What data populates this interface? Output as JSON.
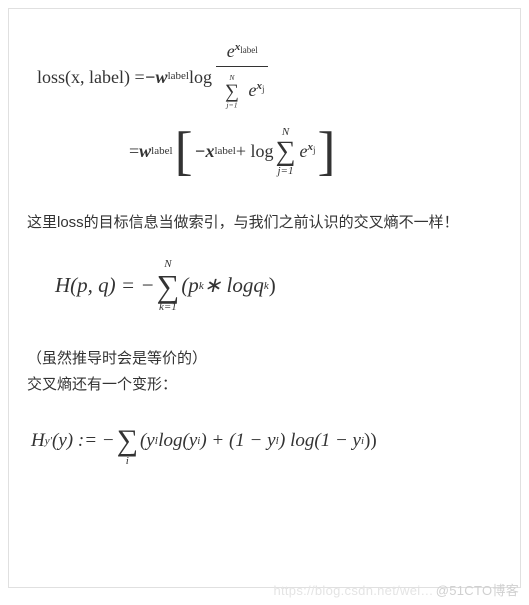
{
  "formula1": {
    "lhs": "loss(x, label) = ",
    "minus_w": "−w",
    "w_sub": "label",
    "log": " log ",
    "frac_num_e": "e",
    "frac_num_exp_x": "x",
    "frac_num_exp_sub": "label",
    "frac_den_sum_top": "N",
    "frac_den_sum_bot": "j=1",
    "frac_den_e": "e",
    "frac_den_exp_x": "x",
    "frac_den_exp_sub": "j",
    "line2_eq": "= ",
    "line2_w": "w",
    "line2_w_sub": "label",
    "line2_minus_x": "−x",
    "line2_x_sub": "label",
    "line2_plus_log": " + log ",
    "line2_sum_top": "N",
    "line2_sum_bot": "j=1",
    "line2_e": "e",
    "line2_exp_x": "x",
    "line2_exp_sub": "j"
  },
  "text1": "这里loss的目标信息当做索引，与我们之前认识的交叉熵不一样！",
  "formula2": {
    "lhs": "H(p, q) = −",
    "sum_top": "N",
    "sum_bot": "k=1",
    "body": "(p",
    "body_sub1": "k",
    "body_mid": " ∗ logq",
    "body_sub2": "k",
    "body_end": ")"
  },
  "text2a": "（虽然推导时会是等价的）",
  "text2b": "交叉熵还有一个变形：",
  "formula3": {
    "lhs_H": "H",
    "lhs_sub": "y′",
    "lhs_arg": "(y) := − ",
    "sum_bot": "i",
    "p1": "(y",
    "p1_sub": "i",
    "p1_prime": "′",
    "p2": " log(y",
    "p2_sub": "i",
    "p3": ") + (1 − y",
    "p3_sub": "i",
    "p3_prime": "′",
    "p4": ") log(1 − y",
    "p4_sub": "i",
    "p5": "))"
  },
  "watermark_left": "https://blog.csdn.net/wei…",
  "watermark_right": "@51CTO博客"
}
